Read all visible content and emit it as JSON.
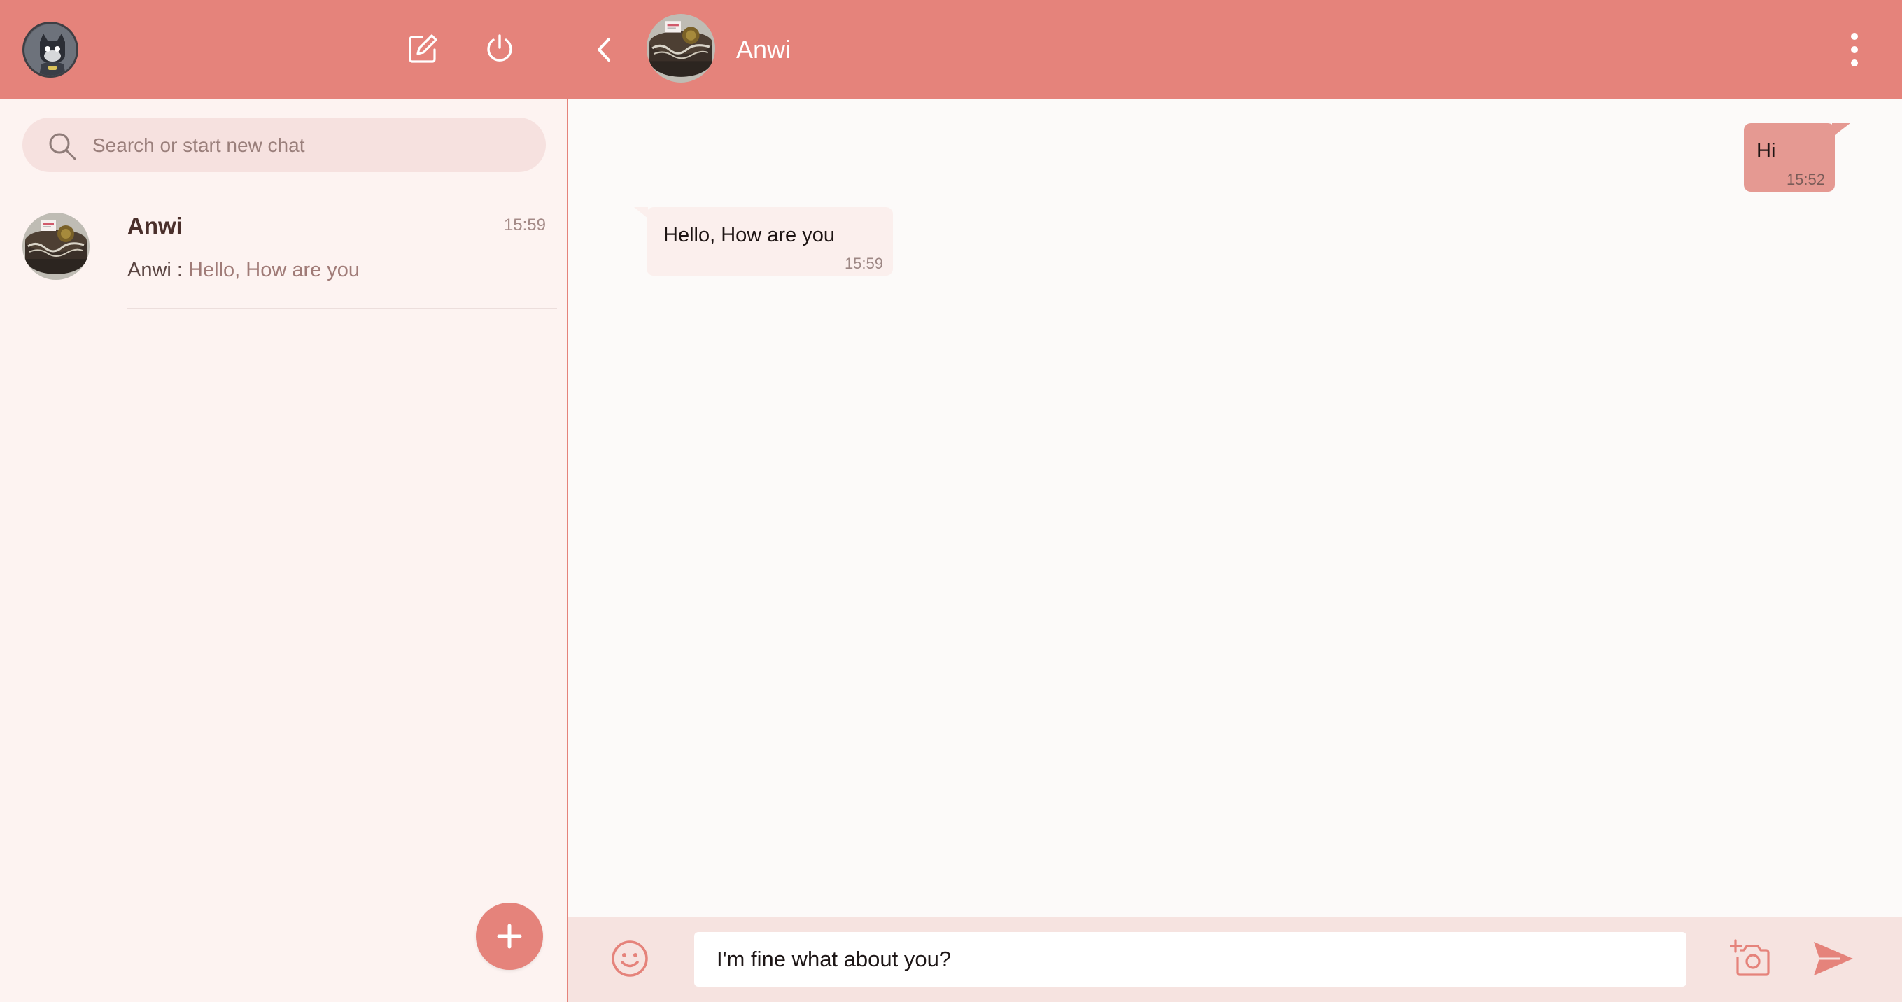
{
  "theme": {
    "accent": "#e5837b",
    "sidebar_bg": "#fdf3f1",
    "chat_bg": "#fcfaf9"
  },
  "sidebar": {
    "header": {
      "my_avatar": "batman-figure-avatar",
      "icons": [
        "edit-icon",
        "power-icon"
      ]
    },
    "search": {
      "placeholder": "Search or start new chat",
      "value": ""
    },
    "chats": [
      {
        "name": "Anwi",
        "time": "15:59",
        "preview_sender": "Anwi :",
        "preview_text": "Hello, How are you",
        "avatar": "cake-avatar"
      }
    ],
    "fab_icon": "plus-icon"
  },
  "conversation": {
    "header": {
      "contact_name": "Anwi",
      "avatar": "cake-avatar",
      "icons": [
        "chevron-left-icon",
        "kebab-menu-icon"
      ]
    },
    "messages": [
      {
        "direction": "outgoing",
        "text": "Hi",
        "time": "15:52"
      },
      {
        "direction": "incoming",
        "text": "Hello, How are you",
        "time": "15:59"
      }
    ],
    "composer": {
      "value": "I'm fine what about you?",
      "icons": [
        "emoji-icon",
        "camera-add-icon",
        "send-icon"
      ]
    }
  }
}
